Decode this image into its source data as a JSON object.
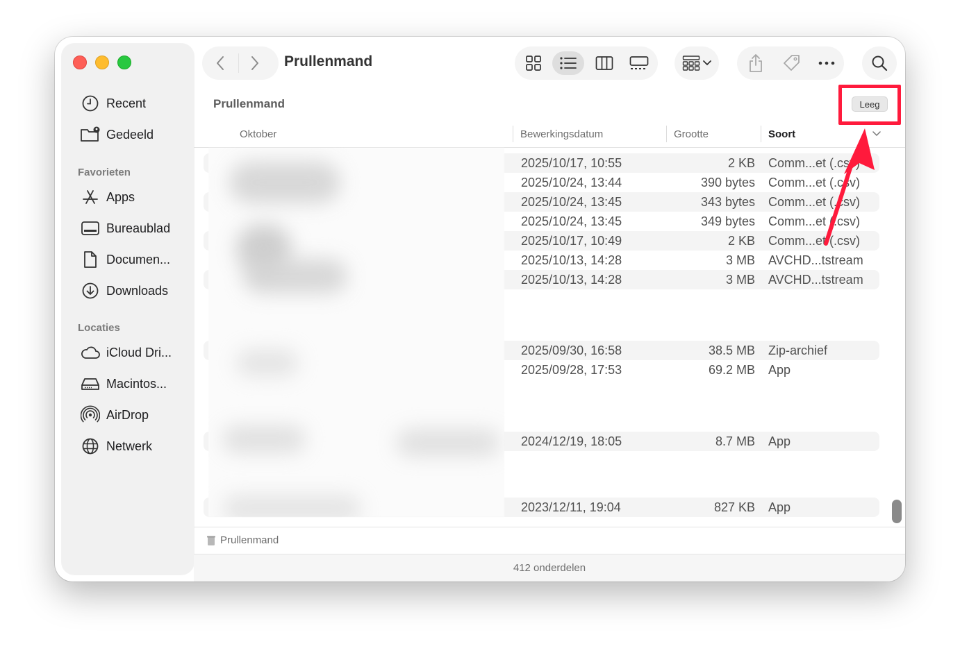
{
  "window": {
    "title": "Prullenmand"
  },
  "sidebar": {
    "items_top": [
      {
        "label": "Recent",
        "icon": "clock-icon"
      },
      {
        "label": "Gedeeld",
        "icon": "shared-folder-icon"
      }
    ],
    "favorites_label": "Favorieten",
    "favorites": [
      {
        "label": "Apps",
        "icon": "apps-icon"
      },
      {
        "label": "Bureaublad",
        "icon": "desktop-icon"
      },
      {
        "label": "Documen...",
        "icon": "document-icon"
      },
      {
        "label": "Downloads",
        "icon": "download-icon"
      }
    ],
    "locations_label": "Locaties",
    "locations": [
      {
        "label": "iCloud Dri...",
        "icon": "cloud-icon"
      },
      {
        "label": "Macintos...",
        "icon": "disk-icon"
      },
      {
        "label": "AirDrop",
        "icon": "airdrop-icon"
      },
      {
        "label": "Netwerk",
        "icon": "network-globe-icon"
      }
    ]
  },
  "content": {
    "location_title": "Prullenmand",
    "empty_button": "Leeg",
    "columns": {
      "name": "Oktober",
      "date": "Bewerkingsdatum",
      "size": "Grootte",
      "kind": "Soort"
    },
    "rows": [
      {
        "date": "2025/10/17, 10:55",
        "size": "2 KB",
        "kind": "Comm...et (.csv)"
      },
      {
        "date": "2025/10/24, 13:44",
        "size": "390 bytes",
        "kind": "Comm...et (.csv)"
      },
      {
        "date": "2025/10/24, 13:45",
        "size": "343 bytes",
        "kind": "Comm...et (.csv)"
      },
      {
        "date": "2025/10/24, 13:45",
        "size": "349 bytes",
        "kind": "Comm...et (.csv)"
      },
      {
        "date": "2025/10/17, 10:49",
        "size": "2 KB",
        "kind": "Comm...et (.csv)"
      },
      {
        "date": "2025/10/13, 14:28",
        "size": "3 MB",
        "kind": "AVCHD...tstream"
      },
      {
        "date": "2025/10/13, 14:28",
        "size": "3 MB",
        "kind": "AVCHD...tstream"
      },
      {
        "date": "2025/09/30, 16:58",
        "size": "38.5 MB",
        "kind": "Zip-archief"
      },
      {
        "date": "2025/09/28, 17:53",
        "size": "69.2 MB",
        "kind": "App"
      },
      {
        "date": "2024/12/19, 18:05",
        "size": "8.7 MB",
        "kind": "App"
      },
      {
        "date": "2023/12/11, 19:04",
        "size": "827 KB",
        "kind": "App"
      }
    ],
    "path": "Prullenmand",
    "status": "412 onderdelen"
  },
  "colors": {
    "highlight": "#ff1a3c",
    "accent": "#ff1a3c"
  }
}
